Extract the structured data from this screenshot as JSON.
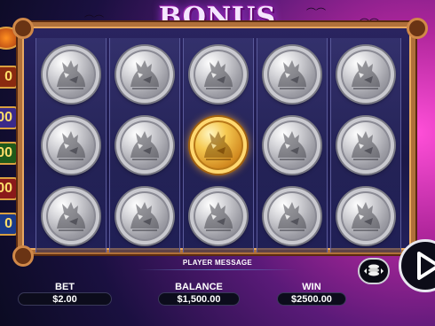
{
  "title": "BONUS",
  "left_meters": [
    {
      "label": "0",
      "color": "#8a2a10"
    },
    {
      "label": "00",
      "color": "#3a2a8a"
    },
    {
      "label": "00",
      "color": "#1f5a1a"
    },
    {
      "label": "00",
      "color": "#8a1a1a"
    },
    {
      "label": "0",
      "color": "#1a3a8a"
    }
  ],
  "reels": [
    [
      "silver-wolf-coin",
      "silver-wolf-coin",
      "silver-wolf-coin"
    ],
    [
      "silver-wolf-coin",
      "silver-wolf-coin",
      "silver-wolf-coin"
    ],
    [
      "silver-wolf-coin",
      "gold-wolf-coin",
      "silver-wolf-coin"
    ],
    [
      "silver-wolf-coin",
      "silver-wolf-coin",
      "silver-wolf-coin"
    ],
    [
      "silver-wolf-coin",
      "silver-wolf-coin",
      "silver-wolf-coin"
    ]
  ],
  "player_message": "PLAYER MESSAGE",
  "bet": {
    "label": "BET",
    "value": "$2.00"
  },
  "balance": {
    "label": "BALANCE",
    "value": "$1,500.00"
  },
  "win": {
    "label": "WIN",
    "value": "$2500.00"
  },
  "icons": {
    "coins": "coin-stack-icon",
    "spin": "play-icon"
  }
}
